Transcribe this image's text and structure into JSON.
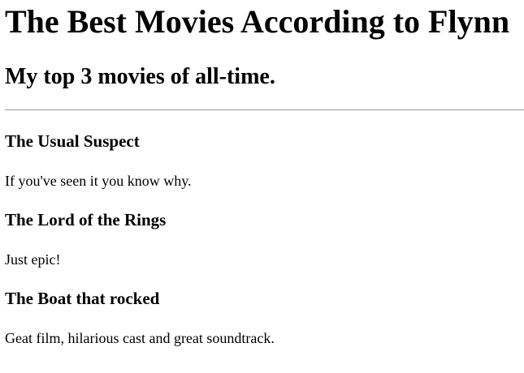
{
  "page": {
    "title": "The Best Movies According to Flynn",
    "subtitle": "My top 3 movies of all-time."
  },
  "movies": [
    {
      "title": "The Usual Suspect",
      "description": "If you've seen it you know why."
    },
    {
      "title": "The Lord of the Rings",
      "description": "Just epic!"
    },
    {
      "title": "The Boat that rocked",
      "description": "Geat film, hilarious cast and great soundtrack."
    }
  ]
}
